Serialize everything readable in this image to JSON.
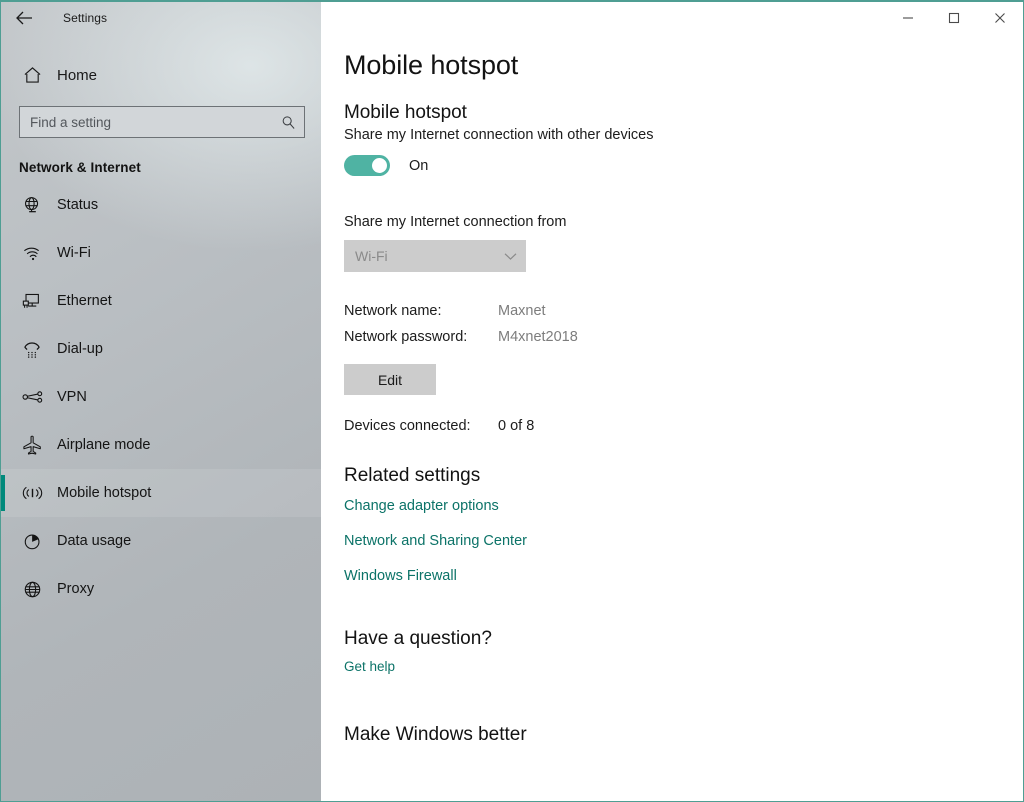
{
  "window": {
    "app_title": "Settings",
    "back_icon": "back-arrow-icon",
    "minimize_label": "—",
    "maximize_label": "□",
    "close_label": "✕",
    "accent_color": "#4f9e93"
  },
  "sidebar": {
    "home": {
      "label": "Home",
      "icon": "home-icon"
    },
    "search": {
      "placeholder": "Find a setting",
      "value": "",
      "icon": "search-icon"
    },
    "group_heading": "Network & Internet",
    "selected": "Mobile hotspot",
    "selection_color": "#00897b",
    "items": [
      {
        "label": "Status",
        "icon": "globe-status-icon"
      },
      {
        "label": "Wi-Fi",
        "icon": "wifi-icon"
      },
      {
        "label": "Ethernet",
        "icon": "ethernet-icon"
      },
      {
        "label": "Dial-up",
        "icon": "dialup-phone-icon"
      },
      {
        "label": "VPN",
        "icon": "vpn-icon"
      },
      {
        "label": "Airplane mode",
        "icon": "airplane-icon"
      },
      {
        "label": "Mobile hotspot",
        "icon": "hotspot-icon"
      },
      {
        "label": "Data usage",
        "icon": "pie-chart-icon"
      },
      {
        "label": "Proxy",
        "icon": "globe-proxy-icon"
      }
    ]
  },
  "main": {
    "page_title": "Mobile hotspot",
    "section": {
      "title": "Mobile hotspot",
      "subtitle": "Share my Internet connection with other devices",
      "toggle_state": "On",
      "toggle_color": "#4fb3a3"
    },
    "share_from": {
      "label": "Share my Internet connection from",
      "selected_value": "Wi-Fi",
      "chevron_icon": "chevron-down-icon"
    },
    "network": {
      "name_label": "Network name:",
      "name_value": "Maxnet",
      "password_label": "Network password:",
      "password_value": "M4xnet2018",
      "edit_label": "Edit"
    },
    "devices": {
      "label": "Devices connected:",
      "value": "0 of 8"
    },
    "related": {
      "title": "Related settings",
      "link_color": "#0c7368",
      "links": [
        "Change adapter options",
        "Network and Sharing Center",
        "Windows Firewall"
      ]
    },
    "question": {
      "title": "Have a question?",
      "link": "Get help"
    },
    "make_better": {
      "title": "Make Windows better"
    }
  }
}
